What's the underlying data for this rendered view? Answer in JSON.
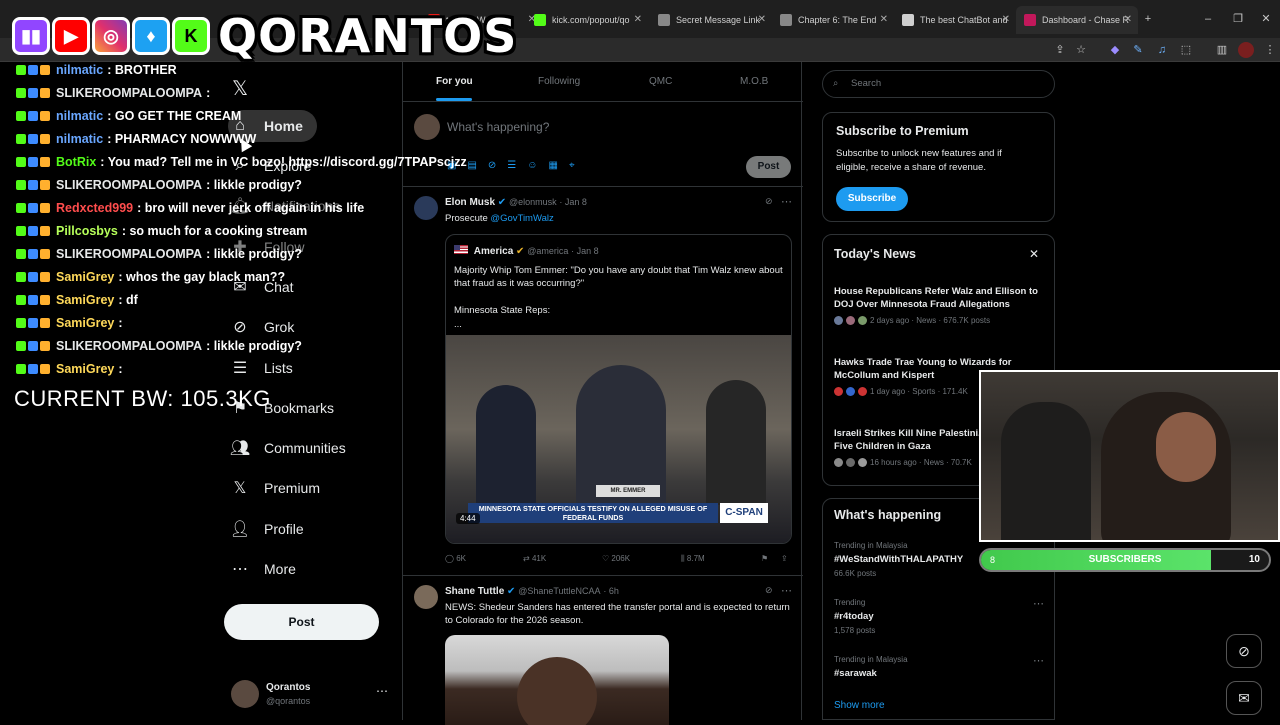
{
  "browser": {
    "tabs": [
      {
        "title": "tream - Watch",
        "color": "#e91916"
      },
      {
        "title": "kick.com/popout/qo",
        "color": "#53fc18"
      },
      {
        "title": "Secret Message Link",
        "color": "#888888"
      },
      {
        "title": "Chapter 6: The End",
        "color": "#888888"
      },
      {
        "title": "The best ChatBot and",
        "color": "#cfcfcf"
      },
      {
        "title": "Dashboard - Chase R",
        "color": "#c2185b"
      }
    ]
  },
  "overlay": {
    "brand": "QORANTOS",
    "socials": [
      "twitch-icon",
      "youtube-icon",
      "instagram-icon",
      "twitter-icon",
      "kick-icon"
    ],
    "chat": [
      {
        "user": "nilmatic",
        "color": "#6aa7ff",
        "text": ": BROTHER"
      },
      {
        "user": "SLIKEROOMPALOOMPA",
        "color": "#e7e9ea",
        "text": ":"
      },
      {
        "user": "nilmatic",
        "color": "#6aa7ff",
        "text": ": GO GET THE CREAM"
      },
      {
        "user": "nilmatic",
        "color": "#6aa7ff",
        "text": ": PHARMACY NOWWWW"
      },
      {
        "user": "BotRix",
        "color": "#53fc18",
        "text": ": You mad? Tell me in VC bozo! https://discord.gg/7TPAPscjzz"
      },
      {
        "user": "SLIKEROOMPALOOMPA",
        "color": "#e7e9ea",
        "text": ": likkle prodigy?"
      },
      {
        "user": "Redxcted999",
        "color": "#ff4d4d",
        "text": ": bro will never jerk off again in his life"
      },
      {
        "user": "Pillcosbys",
        "color": "#b6ff5a",
        "text": ": so much for a cooking stream"
      },
      {
        "user": "SLIKEROOMPALOOMPA",
        "color": "#e7e9ea",
        "text": ": likkle prodigy?"
      },
      {
        "user": "SamiGrey",
        "color": "#ffd95a",
        "text": ": whos the gay black man??"
      },
      {
        "user": "SamiGrey",
        "color": "#ffd95a",
        "text": ": df"
      },
      {
        "user": "SamiGrey",
        "color": "#ffd95a",
        "text": ":"
      },
      {
        "user": "SLIKEROOMPALOOMPA",
        "color": "#e7e9ea",
        "text": ": likkle prodigy?"
      },
      {
        "user": "SamiGrey",
        "color": "#ffd95a",
        "text": ":"
      }
    ],
    "body_weight": "CURRENT BW: 105.3KG",
    "subscribers": {
      "label": "SUBSCRIBERS",
      "current": "8",
      "goal": "10",
      "progress": 0.8
    }
  },
  "nav": {
    "items": [
      {
        "label": "Home",
        "icon": "home-icon"
      },
      {
        "label": "Explore",
        "icon": "search-icon"
      },
      {
        "label": "Notifications",
        "icon": "bell-icon"
      },
      {
        "label": "Follow",
        "icon": "follow-icon"
      },
      {
        "label": "Chat",
        "icon": "mail-icon"
      },
      {
        "label": "Grok",
        "icon": "grok-icon"
      },
      {
        "label": "Lists",
        "icon": "list-icon"
      },
      {
        "label": "Bookmarks",
        "icon": "bookmark-icon"
      },
      {
        "label": "Communities",
        "icon": "people-icon"
      },
      {
        "label": "Premium",
        "icon": "x-icon"
      },
      {
        "label": "Profile",
        "icon": "person-icon"
      },
      {
        "label": "More",
        "icon": "more-icon"
      }
    ],
    "post_label": "Post",
    "account": {
      "name": "Qorantos",
      "handle": "@qorantos"
    }
  },
  "timeline": {
    "tabs": [
      "For you",
      "Following",
      "QMC",
      "M.O.B"
    ],
    "composer": {
      "placeholder": "What's happening?",
      "post": "Post"
    },
    "tweets": [
      {
        "name": "Elon Musk",
        "handle": "@elonmusk",
        "date": "· Jan 8",
        "text_prefix": "Prosecute ",
        "mention": "@GovTimWalz",
        "quote": {
          "name": "America",
          "handle": "@america",
          "date": "· Jan 8",
          "text": "Majority Whip Tom Emmer: \"Do you have any doubt that Tim Walz knew about that fraud as it was occurring?\"",
          "text2": "Minnesota State Reps:",
          "text3": "...",
          "video_time": "4:44",
          "chyron": "MINNESOTA STATE OFFICIALS TESTIFY ON ALLEGED MISUSE OF FEDERAL FUNDS",
          "chyron_tag": "C-SPAN",
          "nameplate": "MR. EMMER"
        },
        "stats": {
          "replies": "6K",
          "reposts": "41K",
          "likes": "206K",
          "views": "8.7M"
        }
      },
      {
        "name": "Shane Tuttle",
        "handle": "@ShaneTuttleNCAA",
        "date": "· 6h",
        "text": "NEWS: Shedeur Sanders has entered the transfer portal and is expected to return to Colorado for the 2026 season."
      }
    ]
  },
  "sidebar": {
    "search_placeholder": "Search",
    "premium": {
      "title": "Subscribe to Premium",
      "text": "Subscribe to unlock new features and if eligible, receive a share of revenue.",
      "button": "Subscribe"
    },
    "news": {
      "title": "Today's News",
      "items": [
        {
          "title": "House Republicans Refer Walz and Ellison to DOJ Over Minnesota Fraud Allegations",
          "meta": "2 days ago · News · 676.7K posts"
        },
        {
          "title": "Hawks Trade Trae Young to Wizards for McCollum and Kispert",
          "meta": "1 day ago · Sports · 171.4K"
        },
        {
          "title": "Israeli Strikes Kill Nine Palestini... Including Five Children in Gaza",
          "meta": "16 hours ago · News · 70.7K"
        }
      ]
    },
    "happening": {
      "title": "What's happening",
      "items": [
        {
          "context": "Trending in Malaysia",
          "topic": "#WeStandWithTHALAPATHY",
          "count": "66.6K posts"
        },
        {
          "context": "Trending",
          "topic": "#r4today",
          "count": "1,578 posts"
        },
        {
          "context": "Trending in Malaysia",
          "topic": "#sarawak",
          "count": ""
        }
      ],
      "show_more": "Show more"
    }
  }
}
